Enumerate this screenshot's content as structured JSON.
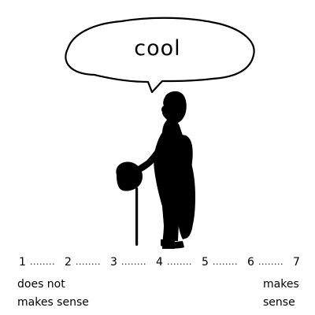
{
  "speech_bubble": {
    "text": "cool"
  },
  "scale": {
    "points": [
      "1",
      "2",
      "3",
      "4",
      "5",
      "6",
      "7"
    ],
    "separator": "........"
  },
  "anchors": {
    "left": [
      "does not",
      "makes sense"
    ],
    "right": [
      "makes",
      "sense"
    ]
  },
  "colors": {
    "ink": "#000000",
    "background": "#ffffff"
  }
}
